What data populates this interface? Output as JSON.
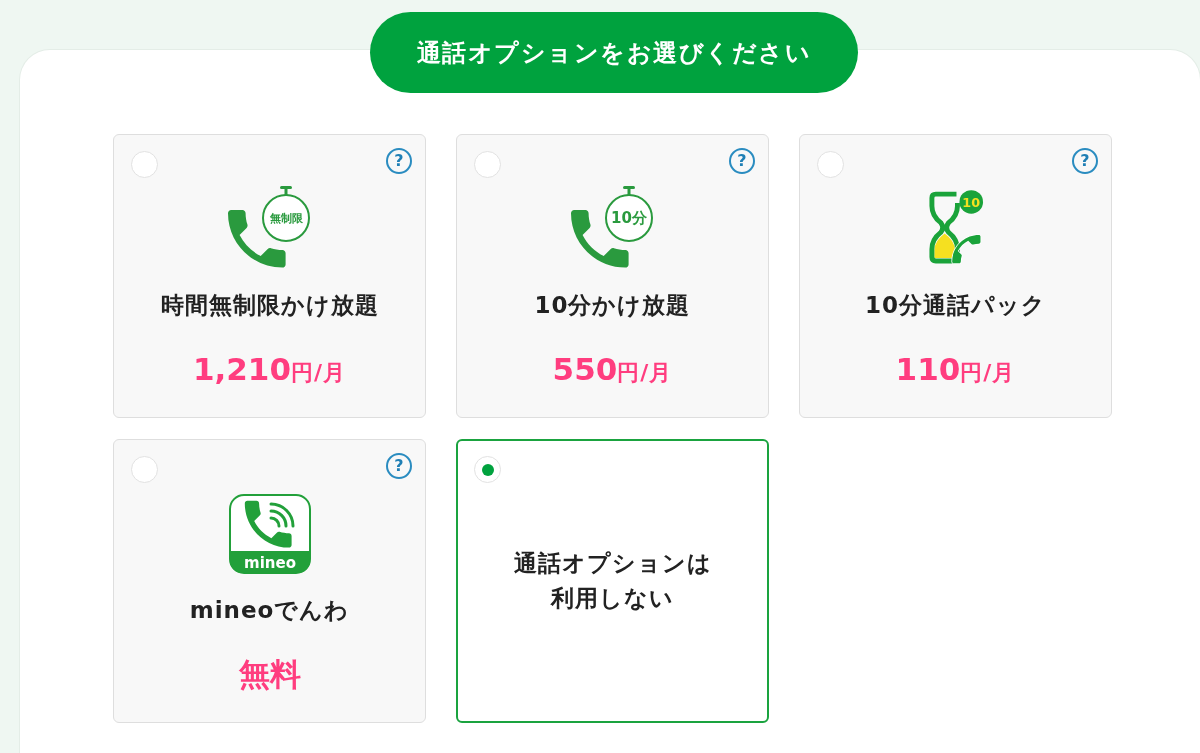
{
  "header": {
    "title": "通話オプションをお選びください"
  },
  "options": [
    {
      "kind": "plan",
      "selected": false,
      "help": "?",
      "icon": {
        "kind": "phone-timer",
        "label": "無制限"
      },
      "title": "時間無制限かけ放題",
      "price": {
        "amount": "1,210",
        "unit": "円/月"
      }
    },
    {
      "kind": "plan",
      "selected": false,
      "help": "?",
      "icon": {
        "kind": "phone-timer",
        "label": "10分"
      },
      "title": "10分かけ放題",
      "price": {
        "amount": "550",
        "unit": "円/月"
      }
    },
    {
      "kind": "plan",
      "selected": false,
      "help": "?",
      "icon": {
        "kind": "hourglass-phone",
        "label": "10"
      },
      "title": "10分通話パック",
      "price": {
        "amount": "110",
        "unit": "円/月"
      }
    },
    {
      "kind": "plan",
      "selected": false,
      "help": "?",
      "icon": {
        "kind": "phone-app",
        "label": "mineo"
      },
      "title": "mineoでんわ",
      "price": {
        "amount": "無料"
      }
    },
    {
      "kind": "none",
      "selected": true,
      "title": "通話オプションは利用しない"
    }
  ]
}
